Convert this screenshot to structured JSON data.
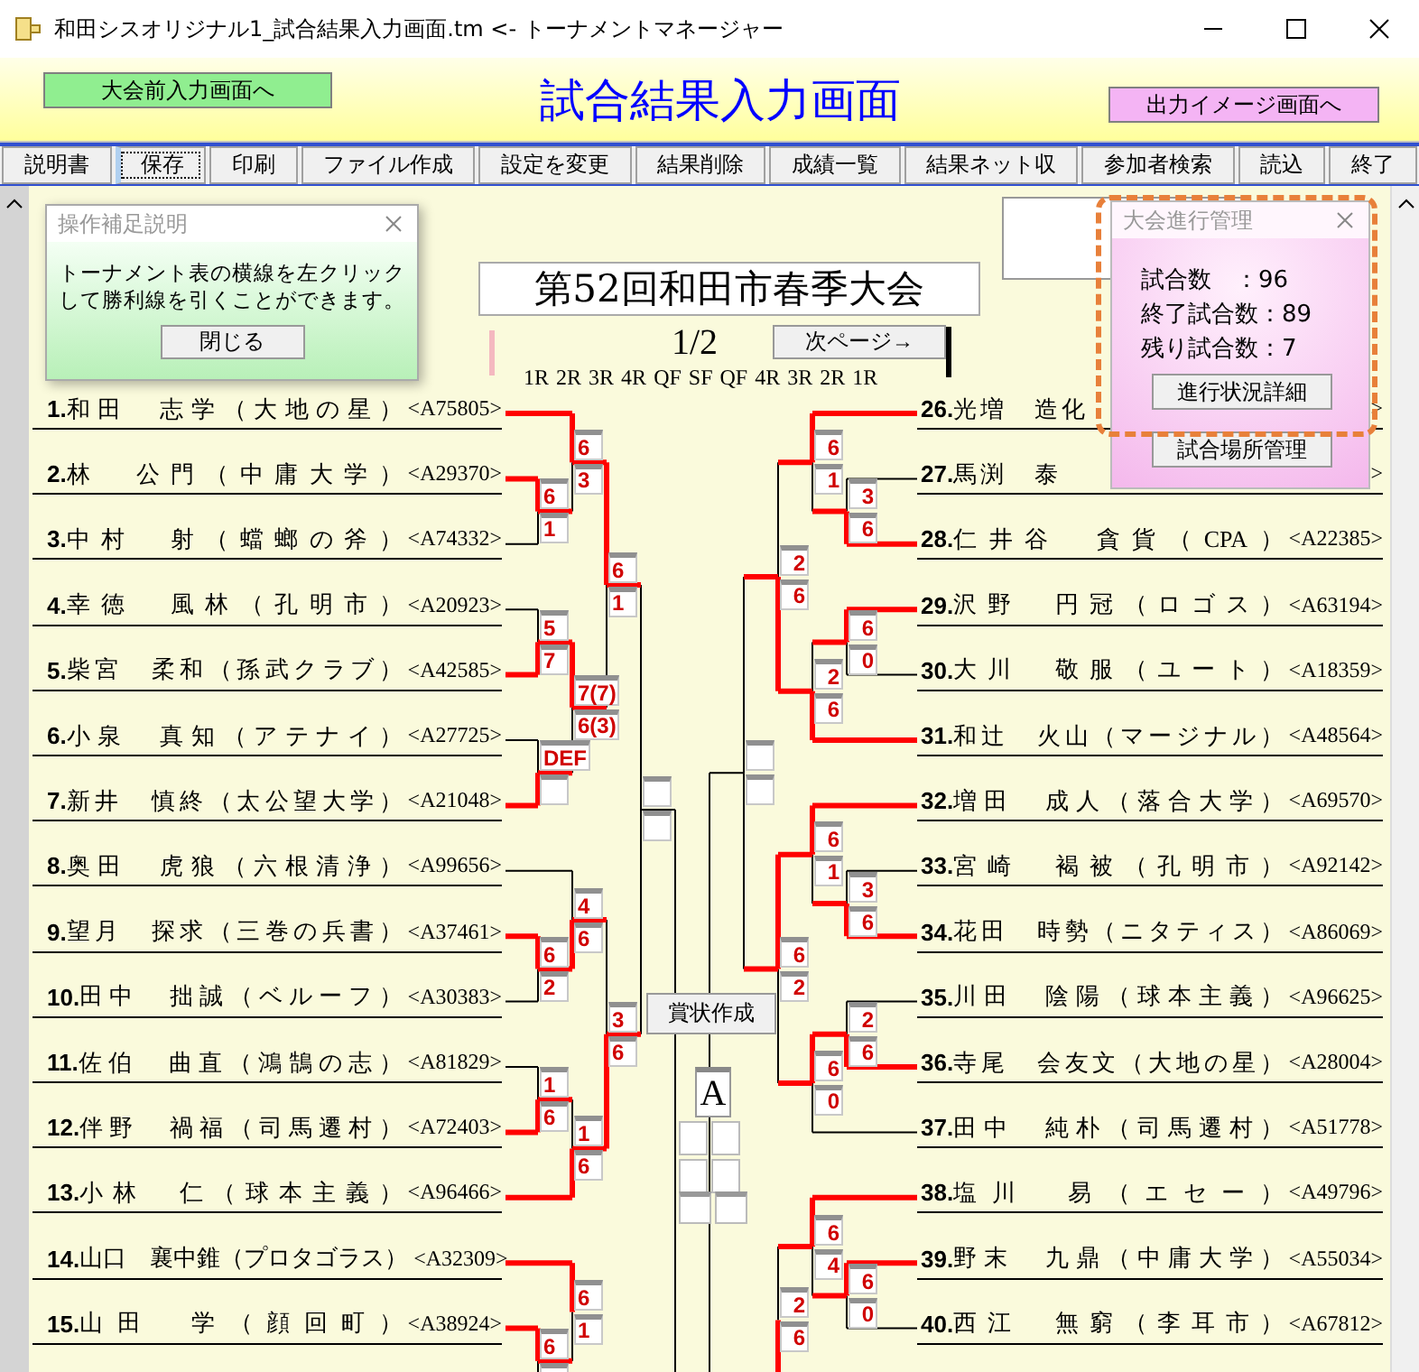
{
  "window": {
    "title": "和田シスオリジナル1_試合結果入力画面.tm <- トーナメントマネージャー"
  },
  "header": {
    "left_button": "大会前入力画面へ",
    "title": "試合結果入力画面",
    "right_button": "出力イメージ画面へ"
  },
  "toolbar": [
    {
      "label": "説明書",
      "focused": false
    },
    {
      "label": "保存",
      "focused": true
    },
    {
      "label": "印刷",
      "focused": false
    },
    {
      "label": "ファイル作成",
      "focused": false
    },
    {
      "label": "設定を変更",
      "focused": false
    },
    {
      "label": "結果削除",
      "focused": false
    },
    {
      "label": "成績一覧",
      "focused": false
    },
    {
      "label": "結果ネット収",
      "focused": false
    },
    {
      "label": "参加者検索",
      "focused": false
    },
    {
      "label": "読込",
      "focused": false
    },
    {
      "label": "終了",
      "focused": false
    }
  ],
  "tournament": {
    "name": "第52回和田市春季大会",
    "page": "1/2",
    "next_button": "次ページ→",
    "rounds": [
      "1R",
      "2R",
      "3R",
      "4R",
      "QF",
      "SF",
      "QF",
      "4R",
      "3R",
      "2R",
      "1R"
    ]
  },
  "left_bracket": [
    {
      "children": [
        {
          "scores": [
            "6",
            "1"
          ],
          "top_won": true,
          "children": [
            {
              "scores": [
                "6",
                "3"
              ],
              "top_won": true,
              "children": [
                {
                  "no": "1.",
                  "name": "和田　志学（大地の星）",
                  "code": "<A75805>"
                },
                {
                  "scores": [
                    "6",
                    "1"
                  ],
                  "top_won": true,
                  "children": [
                    {
                      "no": "2.",
                      "name": "林　公門（中庸大学）",
                      "code": "<A29370>"
                    },
                    {
                      "no": "3.",
                      "name": "中村　射（蟷螂の斧）",
                      "code": "<A74332>"
                    }
                  ]
                }
              ]
            },
            {
              "scores": [
                "7(7)",
                "6(3)"
              ],
              "top_won": true,
              "children": [
                {
                  "scores": [
                    "5",
                    "7"
                  ],
                  "top_won": false,
                  "children": [
                    {
                      "no": "4.",
                      "name": "幸徳　風林（孔明市）",
                      "code": "<A20923>"
                    },
                    {
                      "no": "5.",
                      "name": "柴宮　柔和（孫武クラブ）",
                      "code": "<A42585>"
                    }
                  ]
                },
                {
                  "scores": [
                    "DEF"
                  ],
                  "top_won": false,
                  "children": [
                    {
                      "no": "6.",
                      "name": "小泉　真知（アテナイ）",
                      "code": "<A27725>"
                    },
                    {
                      "no": "7.",
                      "name": "新井　慎終（太公望大学）",
                      "code": "<A21048>"
                    }
                  ]
                }
              ]
            }
          ]
        },
        {
          "scores": [
            "3",
            "6"
          ],
          "top_won": false,
          "children": [
            {
              "scores": [
                "4",
                "6"
              ],
              "top_won": false,
              "children": [
                {
                  "no": "8.",
                  "name": "奥田　虎狼（六根清浄）",
                  "code": "<A99656>"
                },
                {
                  "scores": [
                    "6",
                    "2"
                  ],
                  "top_won": true,
                  "children": [
                    {
                      "no": "9.",
                      "name": "望月　探求（三巻の兵書）",
                      "code": "<A37461>"
                    },
                    {
                      "no": "10.",
                      "name": "田中　拙誠（ベルーフ）",
                      "code": "<A30383>"
                    }
                  ]
                }
              ]
            },
            {
              "scores": [
                "1",
                "6"
              ],
              "top_won": false,
              "children": [
                {
                  "scores": [
                    "1",
                    "6"
                  ],
                  "top_won": false,
                  "children": [
                    {
                      "no": "11.",
                      "name": "佐伯　曲直（鴻鵠の志）",
                      "code": "<A81829>"
                    },
                    {
                      "no": "12.",
                      "name": "伴野　禍福（司馬遷村）",
                      "code": "<A72403>"
                    }
                  ]
                },
                {
                  "no": "13.",
                  "name": "小林　仁（球本主義）",
                  "code": "<A96466>"
                }
              ]
            }
          ]
        }
      ]
    },
    {
      "scores": [
        "6",
        "1"
      ],
      "top_won": true,
      "children": [
        {
          "no": "14.",
          "name": "山口　襄中錐（プロタゴラス）",
          "code": "<A32309>"
        },
        {
          "scores": [
            "6"
          ],
          "top_won": true,
          "children": [
            {
              "no": "15.",
              "name": "山田　学（顔回町）",
              "code": "<A38924>"
            }
          ]
        }
      ]
    }
  ],
  "right_bracket": [
    {
      "children": [
        {
          "scores": [
            "2",
            "6"
          ],
          "top_won": false,
          "children": [
            {
              "scores": [
                "6",
                "1"
              ],
              "top_won": true,
              "children": [
                {
                  "no": "26.",
                  "name": "光増　造化",
                  "code": ">",
                  "covered": true
                },
                {
                  "scores": [
                    "3",
                    "6"
                  ],
                  "top_won": false,
                  "children": [
                    {
                      "no": "27.",
                      "name": "馬渕　泰",
                      "code": ">",
                      "covered": true
                    },
                    {
                      "no": "28.",
                      "name": "仁井谷　貪貨（CPA）",
                      "code": "<A22385>"
                    }
                  ]
                }
              ]
            },
            {
              "scores": [
                "2",
                "6"
              ],
              "top_won": false,
              "children": [
                {
                  "scores": [
                    "6",
                    "0"
                  ],
                  "top_won": true,
                  "children": [
                    {
                      "no": "29.",
                      "name": "沢野　円冠（ロゴス）",
                      "code": "<A63194>"
                    },
                    {
                      "no": "30.",
                      "name": "大川　敬服（ユート）",
                      "code": "<A18359>"
                    }
                  ]
                },
                {
                  "no": "31.",
                  "name": "和辻　火山（マージナル）",
                  "code": "<A48564>"
                }
              ]
            }
          ]
        },
        {
          "scores": [
            "6",
            "2"
          ],
          "top_won": true,
          "children": [
            {
              "scores": [
                "6",
                "1"
              ],
              "top_won": true,
              "children": [
                {
                  "no": "32.",
                  "name": "増田　成人（落合大学）",
                  "code": "<A69570>"
                },
                {
                  "scores": [
                    "3",
                    "6"
                  ],
                  "top_won": false,
                  "children": [
                    {
                      "no": "33.",
                      "name": "宮崎　褐被（孔明市）",
                      "code": "<A92142>"
                    },
                    {
                      "no": "34.",
                      "name": "花田　時勢（ニタティス）",
                      "code": "<A86069>"
                    }
                  ]
                }
              ]
            },
            {
              "scores": [
                "6",
                "0"
              ],
              "top_won": true,
              "children": [
                {
                  "scores": [
                    "2",
                    "6"
                  ],
                  "top_won": false,
                  "children": [
                    {
                      "no": "35.",
                      "name": "川田　陰陽（球本主義）",
                      "code": "<A96625>"
                    },
                    {
                      "no": "36.",
                      "name": "寺尾　会友文（大地の星）",
                      "code": "<A28004>"
                    }
                  ]
                },
                {
                  "no": "37.",
                  "name": "田中　純朴（司馬遷村）",
                  "code": "<A51778>"
                }
              ]
            }
          ]
        }
      ]
    },
    {
      "scores": [
        "2",
        "6"
      ],
      "top_won": false,
      "children": [
        {
          "scores": [
            "6",
            "4"
          ],
          "top_won": true,
          "children": [
            {
              "no": "38.",
              "name": "塩川　易（エセー）",
              "code": "<A49796>"
            },
            {
              "scores": [
                "6",
                "0"
              ],
              "top_won": true,
              "children": [
                {
                  "no": "39.",
                  "name": "野末　九鼎（中庸大学）",
                  "code": "<A55034>"
                },
                {
                  "no": "40.",
                  "name": "西江　無窮（李耳市）",
                  "code": "<A67812>"
                }
              ]
            }
          ]
        }
      ]
    }
  ],
  "award_button": "賞状作成",
  "final_block": {
    "label": "A"
  },
  "help_popup": {
    "title": "操作補足説明",
    "lines": [
      "トーナメント表の横線を左クリック",
      "して勝利線を引くことができます。"
    ],
    "button": "閉じる"
  },
  "progress_popup": {
    "title": "大会進行管理",
    "lines": [
      "試合数　：96",
      "終了試合数：89",
      "残り試合数：7"
    ],
    "button": "進行状況詳細",
    "highlighted": true
  },
  "venue_button": "試合場所管理"
}
